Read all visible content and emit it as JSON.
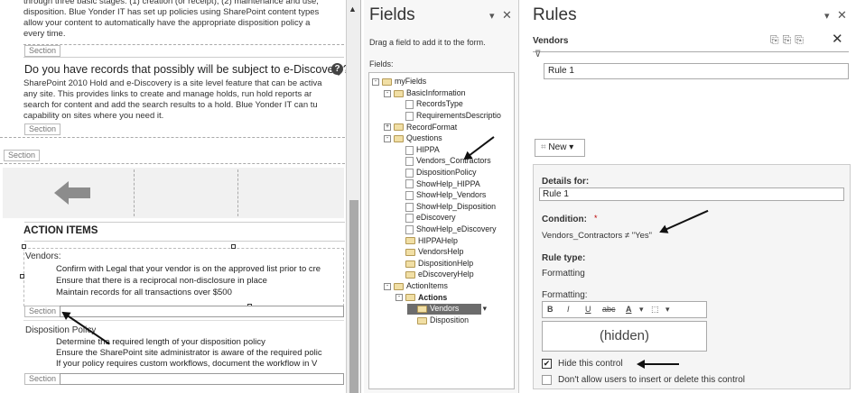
{
  "canvas": {
    "intro_lines": [
      "through three basic stages: (1) creation (or receipt), (2) maintenance and use,",
      "disposition.  Blue Yonder IT has set up policies using SharePoint content types",
      "allow your content to automatically have the appropriate disposition policy a",
      "every time."
    ],
    "section_label": "Section",
    "ediscovery_question": "Do you have records that possibly will be subject to e-Discovery?",
    "ediscovery_lines": [
      "SharePoint 2010 Hold and e-Discovery is a site level feature that can be activa",
      "any site.  This provides links to create and manage holds, run hold reports ar",
      "search for content and add the search results to a hold.  Blue Yonder IT can tu",
      "capability on sites where you need it."
    ],
    "action_items_title": "ACTION ITEMS",
    "vendors_label": "Vendors:",
    "vendor_bullets": [
      "Confirm with Legal that your vendor is on the approved list prior to cre",
      "Ensure that there is a reciprocal non-disclosure in place",
      "Maintain records for all transactions over $500"
    ],
    "disposition_title": "Disposition Policy",
    "disposition_bullets": [
      "Determine the required length of your disposition policy",
      "Ensure the SharePoint site administrator is aware of the required polic",
      "If your policy requires custom workflows, document the workflow in V"
    ]
  },
  "fields_pane": {
    "title": "Fields",
    "hint": "Drag a field to add it to the form.",
    "fields_label": "Fields:",
    "tree": [
      {
        "label": "myFields",
        "depth": 0,
        "kind": "folder",
        "exp": "-"
      },
      {
        "label": "BasicInformation",
        "depth": 1,
        "kind": "folder",
        "exp": "-"
      },
      {
        "label": "RecordsType",
        "depth": 2,
        "kind": "field"
      },
      {
        "label": "RequirementsDescriptio",
        "depth": 2,
        "kind": "field"
      },
      {
        "label": "RecordFormat",
        "depth": 1,
        "kind": "folder",
        "exp": "+"
      },
      {
        "label": "Questions",
        "depth": 1,
        "kind": "folder",
        "exp": "-"
      },
      {
        "label": "HIPPA",
        "depth": 2,
        "kind": "field"
      },
      {
        "label": "Vendors_Contractors",
        "depth": 2,
        "kind": "field"
      },
      {
        "label": "DispositionPolicy",
        "depth": 2,
        "kind": "field"
      },
      {
        "label": "ShowHelp_HIPPA",
        "depth": 2,
        "kind": "field"
      },
      {
        "label": "ShowHelp_Vendors",
        "depth": 2,
        "kind": "field"
      },
      {
        "label": "ShowHelp_Disposition",
        "depth": 2,
        "kind": "field"
      },
      {
        "label": "eDiscovery",
        "depth": 2,
        "kind": "field"
      },
      {
        "label": "ShowHelp_eDiscovery",
        "depth": 2,
        "kind": "field"
      },
      {
        "label": "HIPPAHelp",
        "depth": 2,
        "kind": "folder"
      },
      {
        "label": "VendorsHelp",
        "depth": 2,
        "kind": "folder"
      },
      {
        "label": "DispositionHelp",
        "depth": 2,
        "kind": "folder"
      },
      {
        "label": "eDiscoveryHelp",
        "depth": 2,
        "kind": "folder"
      },
      {
        "label": "ActionItems",
        "depth": 1,
        "kind": "folder",
        "exp": "-"
      },
      {
        "label": "Actions",
        "depth": 2,
        "kind": "folder",
        "exp": "-",
        "bold": true
      },
      {
        "label": "Vendors",
        "depth": 3,
        "kind": "folder",
        "selected": true
      },
      {
        "label": "Disposition",
        "depth": 3,
        "kind": "folder"
      }
    ]
  },
  "rules_pane": {
    "title": "Rules",
    "subtitle": "Vendors",
    "rule_name": "Rule 1",
    "new_button": "New",
    "details_for_label": "Details for:",
    "details_for_value": "Rule 1",
    "condition_label": "Condition:",
    "condition_value": "Vendors_Contractors ≠ \"Yes\"",
    "rule_type_label": "Rule type:",
    "rule_type_value": "Formatting",
    "formatting_label": "Formatting:",
    "preview_text": "(hidden)",
    "hide_label": "Hide this control",
    "dont_allow_label": "Don't allow users to insert or delete this control"
  }
}
